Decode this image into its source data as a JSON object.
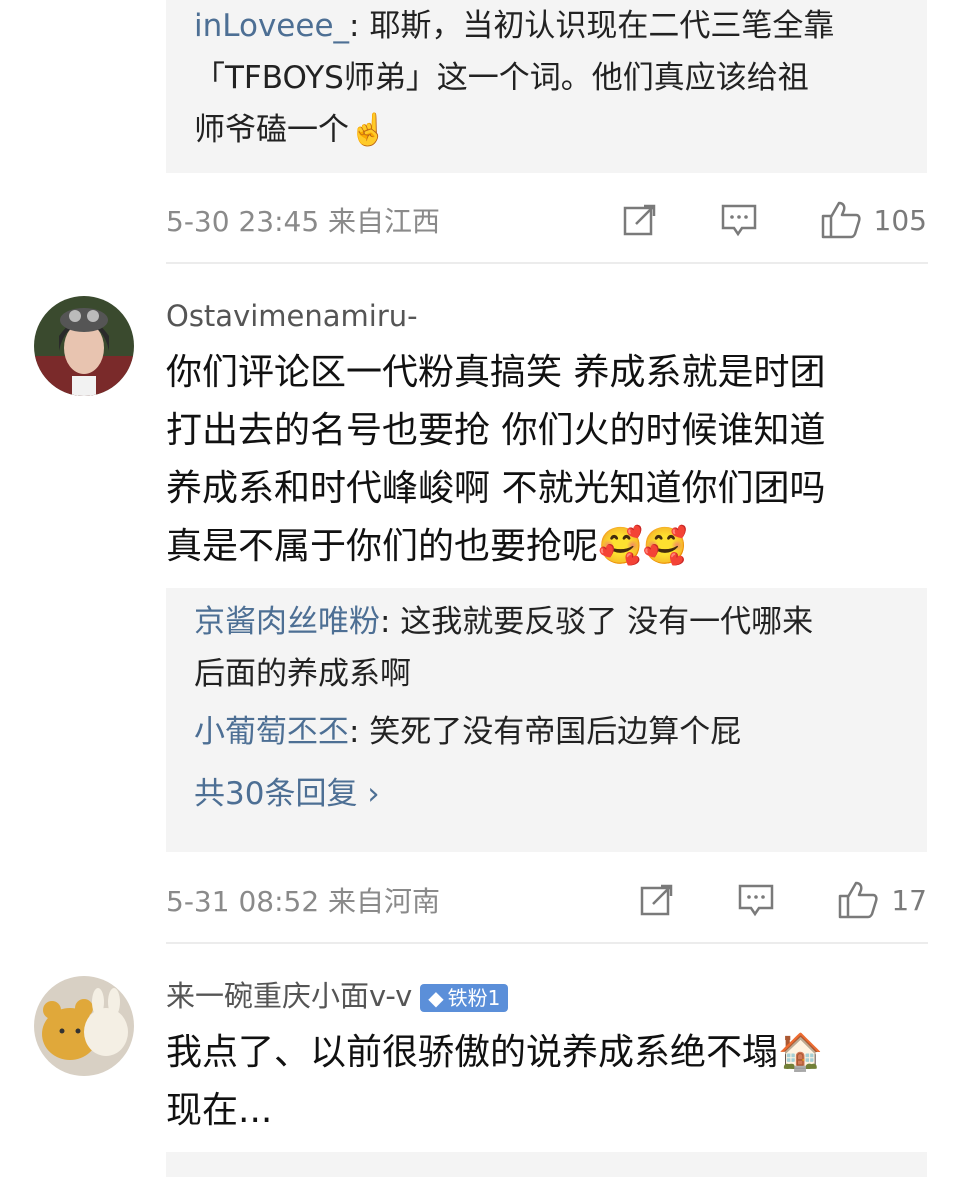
{
  "comment_top": {
    "reply": {
      "name": "inLoveee_",
      "text_line1": ": 耶斯，当初认识现在二代三笔全靠",
      "text_line2": "「TFBOYS师弟」这一个词。他们真应该给祖",
      "text_line3": "师爷磕一个☝️"
    },
    "meta": {
      "time_location": "5-30 23:45  来自江西",
      "like_count": "105"
    }
  },
  "comment_2": {
    "username": "Ostavimenamiru-",
    "body": [
      "你们评论区一代粉真搞笑  养成系就是时团",
      "打出去的名号也要抢   你们火的时候谁知道",
      "养成系和时代峰峻啊   不就光知道你们团吗",
      "真是不属于你们的也要抢呢🥰🥰"
    ],
    "replies": [
      {
        "name": "京酱肉丝唯粉",
        "text1": ": 这我就要反驳了 没有一代哪来",
        "text2": "后面的养成系啊"
      },
      {
        "name": "小葡萄丕丕",
        "text1": ": 笑死了没有帝国后边算个屁"
      }
    ],
    "more_replies": "共30条回复 ›",
    "meta": {
      "time_location": "5-31 08:52  来自河南",
      "like_count": "17"
    }
  },
  "comment_3": {
    "username": "来一碗重庆小面v-v",
    "badge": "铁粉1",
    "body": [
      "我点了、以前很骄傲的说养成系绝不塌🏠",
      "现在..."
    ]
  },
  "icons": {
    "share": "share-icon",
    "comment": "comment-icon",
    "like": "thumbs-up-icon"
  },
  "colors": {
    "link": "#4d6f94",
    "meta": "#8a8a8a",
    "reply_bg": "#f4f4f4",
    "badge": "#5b8fd9"
  }
}
